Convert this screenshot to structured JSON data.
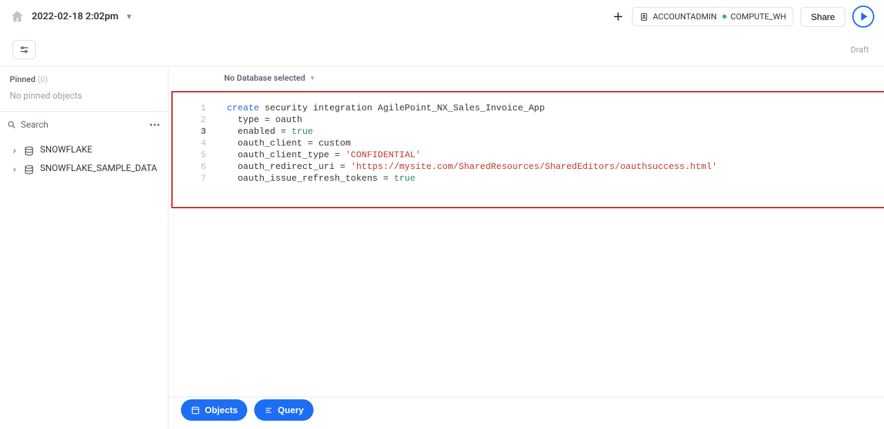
{
  "header": {
    "title": "2022-02-18 2:02pm",
    "role_label": "ACCOUNTADMIN",
    "warehouse_label": "COMPUTE_WH",
    "share_label": "Share",
    "draft_label": "Draft"
  },
  "sidebar": {
    "pinned_label": "Pinned",
    "pinned_count": "(0)",
    "no_pinned_text": "No pinned objects",
    "search_placeholder": "Search",
    "tree": [
      {
        "name": "SNOWFLAKE"
      },
      {
        "name": "SNOWFLAKE_SAMPLE_DATA"
      }
    ]
  },
  "editor": {
    "db_selector_label": "No Database selected",
    "active_line": 3,
    "lines": [
      [
        {
          "t": "kw",
          "v": "create"
        },
        {
          "t": "p",
          "v": " security integration AgilePoint_NX_Sales_Invoice_App"
        }
      ],
      [
        {
          "t": "p",
          "v": "  type = oauth"
        }
      ],
      [
        {
          "t": "p",
          "v": "  enabled = "
        },
        {
          "t": "bool",
          "v": "true"
        }
      ],
      [
        {
          "t": "p",
          "v": "  oauth_client = custom"
        }
      ],
      [
        {
          "t": "p",
          "v": "  oauth_client_type = "
        },
        {
          "t": "str",
          "v": "'CONFIDENTIAL'"
        }
      ],
      [
        {
          "t": "p",
          "v": "  oauth_redirect_uri = "
        },
        {
          "t": "str",
          "v": "'https://mysite.com/SharedResources/SharedEditors/oauthsuccess.html'"
        }
      ],
      [
        {
          "t": "p",
          "v": "  oauth_issue_refresh_tokens = "
        },
        {
          "t": "bool",
          "v": "true"
        }
      ]
    ]
  },
  "bottom": {
    "objects_label": "Objects",
    "query_label": "Query"
  }
}
